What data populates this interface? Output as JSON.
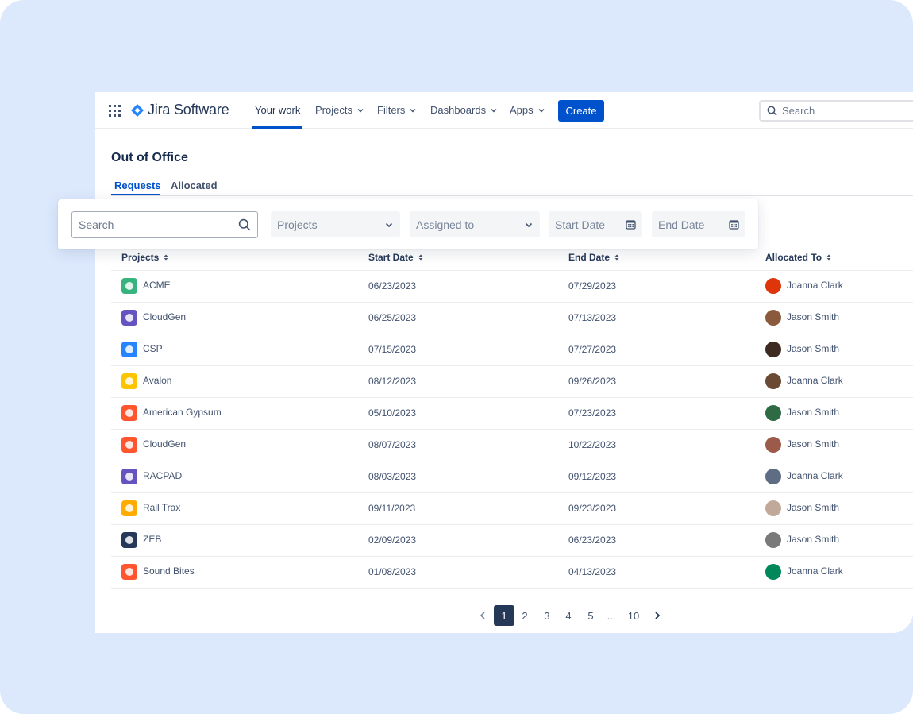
{
  "nav": {
    "product_name": "Jira Software",
    "items": [
      {
        "label": "Your work"
      },
      {
        "label": "Projects"
      },
      {
        "label": "Filters"
      },
      {
        "label": "Dashboards"
      },
      {
        "label": "Apps"
      }
    ],
    "create_label": "Create",
    "search_placeholder": "Search"
  },
  "page": {
    "title": "Out of Office",
    "tabs": [
      {
        "label": "Requests"
      },
      {
        "label": "Allocated"
      }
    ]
  },
  "filters": {
    "search_placeholder": "Search",
    "projects_placeholder": "Projects",
    "assigned_placeholder": "Assigned to",
    "start_date_placeholder": "Start Date",
    "end_date_placeholder": "End Date"
  },
  "table": {
    "columns": [
      "Projects",
      "Start Date",
      "End Date",
      "Allocated To"
    ],
    "rows": [
      {
        "project": "ACME",
        "start": "06/23/2023",
        "end": "07/29/2023",
        "allocated": "Joanna Clark",
        "icon": "acme-icon",
        "icon_color": "#36B37E",
        "avatar_color": "#DE350B"
      },
      {
        "project": "CloudGen",
        "start": "06/25/2023",
        "end": "07/13/2023",
        "allocated": "Jason Smith",
        "icon": "cloudgen-icon",
        "icon_color": "#6554C0",
        "avatar_color": "#8B5A3C"
      },
      {
        "project": "CSP",
        "start": "07/15/2023",
        "end": "07/27/2023",
        "allocated": "Jason Smith",
        "icon": "cloud-icon",
        "icon_color": "#2684FF",
        "avatar_color": "#3D2B22"
      },
      {
        "project": "Avalon",
        "start": "08/12/2023",
        "end": "09/26/2023",
        "allocated": "Joanna Clark",
        "icon": "avalon-icon",
        "icon_color": "#FFC400",
        "avatar_color": "#6B4A35"
      },
      {
        "project": "American Gypsum",
        "start": "05/10/2023",
        "end": "07/23/2023",
        "allocated": "Jason Smith",
        "icon": "american-gypsum-icon",
        "icon_color": "#FF5630",
        "avatar_color": "#2E6B45"
      },
      {
        "project": "CloudGen",
        "start": "08/07/2023",
        "end": "10/22/2023",
        "allocated": "Jason Smith",
        "icon": "cloudgen-alt-icon",
        "icon_color": "#FF5630",
        "avatar_color": "#9C5A4A"
      },
      {
        "project": "RACPAD",
        "start": "08/03/2023",
        "end": "09/12/2023",
        "allocated": "Joanna Clark",
        "icon": "racpad-icon",
        "icon_color": "#6554C0",
        "avatar_color": "#5E6C84"
      },
      {
        "project": "Rail Trax",
        "start": "09/11/2023",
        "end": "09/23/2023",
        "allocated": "Jason Smith",
        "icon": "rail-trax-icon",
        "icon_color": "#FFAB00",
        "avatar_color": "#C1A99A"
      },
      {
        "project": "ZEB",
        "start": "02/09/2023",
        "end": "06/23/2023",
        "allocated": "Jason Smith",
        "icon": "rocket-icon",
        "icon_color": "#253858",
        "avatar_color": "#7A7A7A"
      },
      {
        "project": "Sound Bites",
        "start": "01/08/2023",
        "end": "04/13/2023",
        "allocated": "Joanna Clark",
        "icon": "sound-bites-icon",
        "icon_color": "#FF5630",
        "avatar_color": "#00875A"
      }
    ]
  },
  "pagination": {
    "pages": [
      "1",
      "2",
      "3",
      "4",
      "5",
      "...",
      "10"
    ],
    "current": "1"
  }
}
